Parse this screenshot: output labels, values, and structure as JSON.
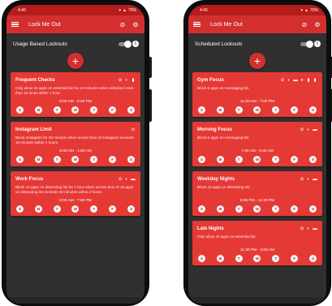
{
  "status": {
    "time": "4:40",
    "right": "70%"
  },
  "app": {
    "title": "Lock Me Out"
  },
  "left": {
    "section": "Usage Based Lockouts",
    "cards": [
      {
        "title": "Frequent Checks",
        "icons": [
          "⊘",
          "◐",
          "▮"
        ],
        "desc": "Only allow 42 apps on essential list for 10 minutes when unlocked more than 10 times within 1 hour.",
        "time": "9:00 AM - 9:00 PM",
        "days": [
          "S",
          "M",
          "T",
          "W",
          "T",
          "F",
          "S"
        ]
      },
      {
        "title": "Instagram Limit",
        "icons": [
          "⊘"
        ],
        "desc": "Block Instagram for 30 minutes when screen time of Instagram exceeds 10 minutes within 2 hours.",
        "time": "8:00 AM - 1:00 AM",
        "days": [
          "S",
          "M",
          "T",
          "W",
          "T",
          "F",
          "S"
        ]
      },
      {
        "title": "Work Focus",
        "icons": [
          "⊘",
          "◐",
          "▬"
        ],
        "desc": "Block 15 apps on distracting list for 1 hour when screen time of 15 apps on distracting list exceeds 30 minutes within 2 hours.",
        "time": "9:00 AM - 7:00 PM",
        "days": [
          "S",
          "M",
          "T",
          "W",
          "T",
          "F",
          "S"
        ]
      }
    ]
  },
  "right": {
    "section": "Scheduled Lockouts",
    "cards": [
      {
        "title": "Gym Focus",
        "icons": [
          "⊘",
          "◐",
          "▬",
          "♦",
          "▮",
          "▮"
        ],
        "desc": "Block 6 apps on messaging list.",
        "time": "11:00 AM - 7:00 PM",
        "days": [
          "S",
          "M",
          "T",
          "W",
          "T",
          "F",
          "S"
        ]
      },
      {
        "title": "Morning Focus",
        "icons": [
          "⊘",
          "◐",
          "▬"
        ],
        "desc": "Block 6 apps on messaging list.",
        "time": "7:00 AM - 9:30 AM",
        "days": [
          "S",
          "M",
          "T",
          "W",
          "T",
          "F",
          "S"
        ]
      },
      {
        "title": "Weekday Nights",
        "icons": [
          "⊘",
          "◐",
          "▬"
        ],
        "desc": "Block 15 apps on distracting list.",
        "time": "8:00 PM - 11:30 PM",
        "days": [
          "S",
          "M",
          "T",
          "W",
          "T",
          "F",
          "S"
        ]
      },
      {
        "title": "Late Nights",
        "icons": [
          "⊘",
          "◐",
          "▬"
        ],
        "desc": "Only allow 42 apps on essential list.",
        "time": "11:30 PM - 4:00 AM",
        "days": [
          "S",
          "M",
          "T",
          "W",
          "T",
          "F",
          "S"
        ]
      }
    ]
  }
}
